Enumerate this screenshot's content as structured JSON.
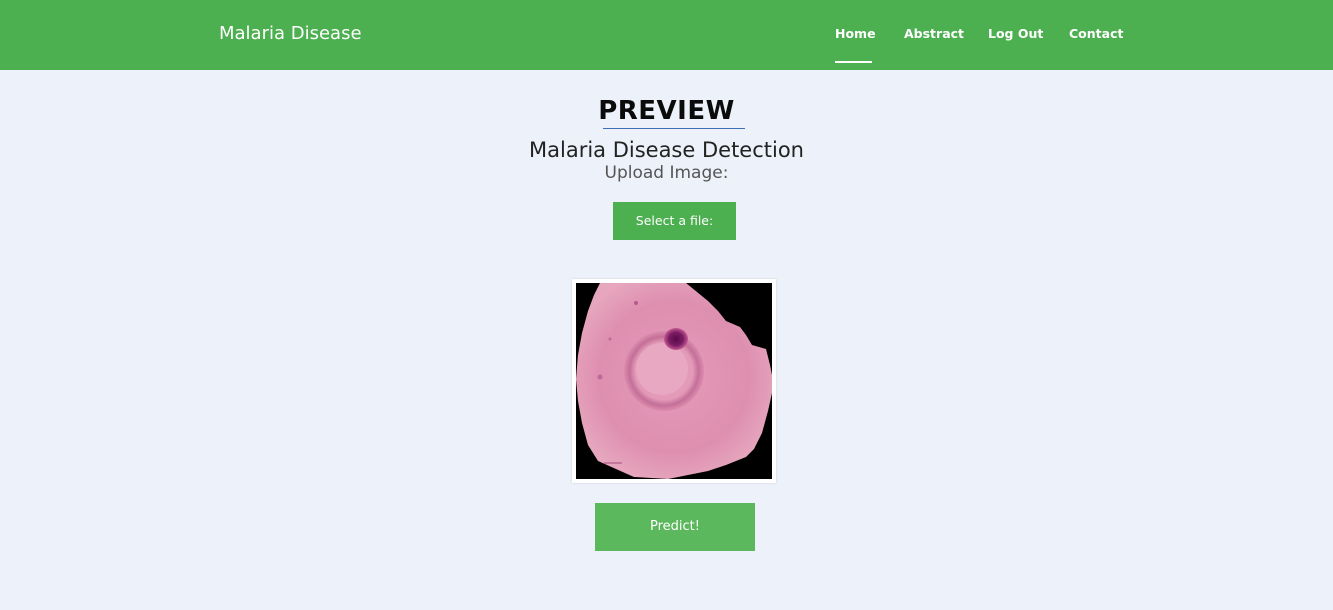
{
  "navbar": {
    "brand": "Malaria Disease",
    "links": [
      {
        "label": "Home",
        "active": true
      },
      {
        "label": "Abstract",
        "active": false
      },
      {
        "label": "Log Out",
        "active": false
      },
      {
        "label": "Contact",
        "active": false
      }
    ],
    "background_color": "#4caf50"
  },
  "main": {
    "heading": "PREVIEW",
    "subtitle": "Malaria Disease Detection",
    "upload_label": "Upload Image:",
    "select_button": "Select a file:",
    "predict_button": "Predict!"
  },
  "colors": {
    "accent": "#4caf50",
    "page_background": "#edf1f9",
    "heading_rule": "#3f6fb8"
  }
}
